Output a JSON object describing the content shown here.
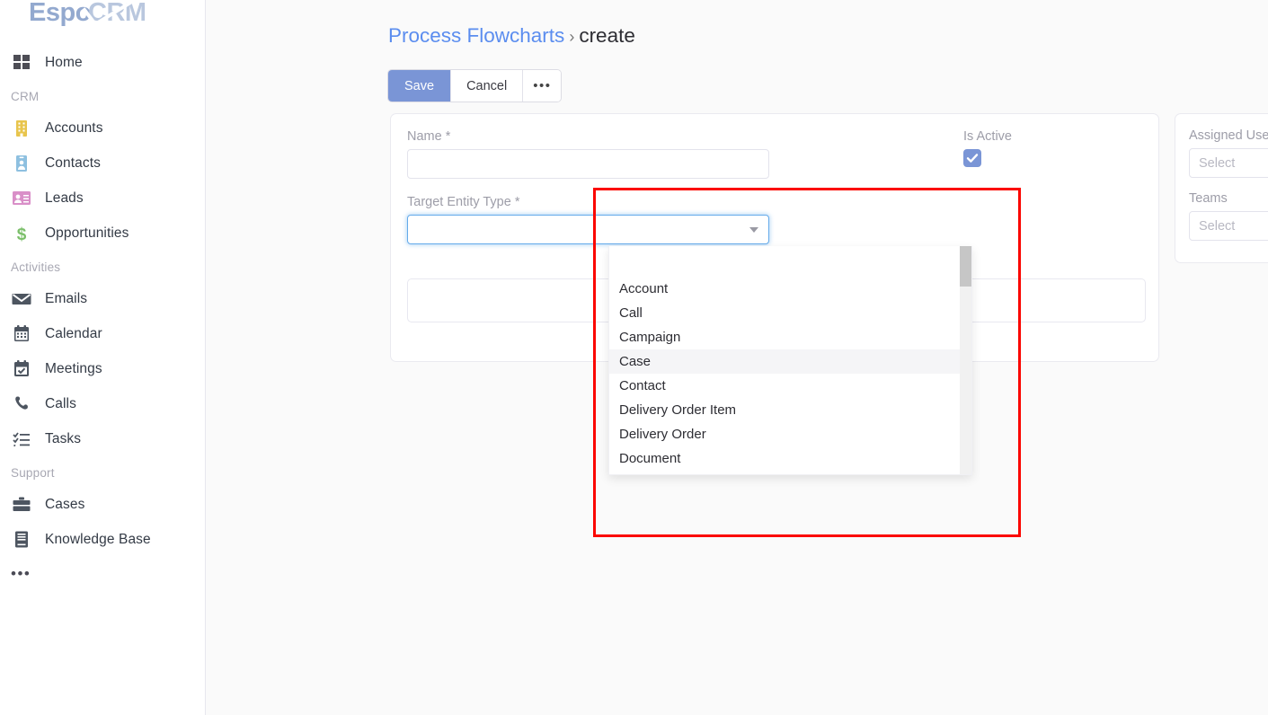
{
  "app": {
    "brand": "EspoCRM",
    "brand_part_1": "Espo",
    "brand_part_2": "CRM",
    "accent_blue": "#7a95d6",
    "link_blue": "#5b8def",
    "highlight_red": "#fb0600"
  },
  "sidebar": {
    "items": [
      {
        "label": "Home",
        "icon": "grid-icon",
        "type": "link",
        "color": "#4d4d55"
      },
      {
        "label": "CRM",
        "icon": "",
        "type": "group"
      },
      {
        "label": "Accounts",
        "icon": "building-icon",
        "type": "link",
        "color": "#e8c54d"
      },
      {
        "label": "Contacts",
        "icon": "contact-card-icon",
        "type": "link",
        "color": "#8ec0e0"
      },
      {
        "label": "Leads",
        "icon": "id-card-icon",
        "type": "link",
        "color": "#d98fc8"
      },
      {
        "label": "Opportunities",
        "icon": "dollar-icon",
        "type": "link",
        "color": "#7bbf6a"
      },
      {
        "label": "Activities",
        "icon": "",
        "type": "group"
      },
      {
        "label": "Emails",
        "icon": "envelope-icon",
        "type": "link",
        "color": "#4d5560"
      },
      {
        "label": "Calendar",
        "icon": "calendar-icon",
        "type": "link",
        "color": "#4d5560"
      },
      {
        "label": "Meetings",
        "icon": "calendar-check-icon",
        "type": "link",
        "color": "#4d5560"
      },
      {
        "label": "Calls",
        "icon": "phone-icon",
        "type": "link",
        "color": "#4d5560"
      },
      {
        "label": "Tasks",
        "icon": "task-list-icon",
        "type": "link",
        "color": "#4d5560"
      },
      {
        "label": "Support",
        "icon": "",
        "type": "group"
      },
      {
        "label": "Cases",
        "icon": "briefcase-icon",
        "type": "link",
        "color": "#4d5560"
      },
      {
        "label": "Knowledge Base",
        "icon": "book-icon",
        "type": "link",
        "color": "#4d5560"
      }
    ],
    "more_label": "•••"
  },
  "breadcrumb": {
    "parent": "Process Flowcharts",
    "separator": "›",
    "current": "create"
  },
  "toolbar": {
    "save_label": "Save",
    "cancel_label": "Cancel",
    "more_label": "•••"
  },
  "form": {
    "name": {
      "label": "Name *",
      "value": "",
      "placeholder": ""
    },
    "is_active": {
      "label": "Is Active",
      "checked": true
    },
    "target_entity_type": {
      "label": "Target Entity Type *",
      "value": "",
      "placeholder": ""
    },
    "description": {
      "label": "",
      "value": "",
      "placeholder": ""
    }
  },
  "side_panel": {
    "assigned_user": {
      "label": "Assigned User",
      "value": "",
      "placeholder": "Select"
    },
    "teams": {
      "label": "Teams",
      "value": "",
      "placeholder": "Select"
    }
  },
  "dropdown": {
    "open": true,
    "highlighted": "Case",
    "options": [
      "Account",
      "Call",
      "Campaign",
      "Case",
      "Contact",
      "Delivery Order Item",
      "Delivery Order",
      "Document"
    ]
  }
}
